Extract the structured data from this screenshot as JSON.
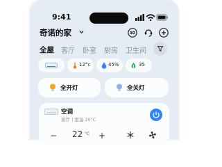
{
  "status": {
    "time": "9:41"
  },
  "header": {
    "title": "奇诺的家"
  },
  "tabs": [
    "全屋",
    "客厅",
    "卧室",
    "厨房",
    "卫生间"
  ],
  "chips": [
    {
      "icon": "ac-unit-icon",
      "text": ""
    },
    {
      "icon": "thermometer-icon",
      "text": "12°c"
    },
    {
      "icon": "humidity-icon",
      "text": "45%"
    },
    {
      "icon": "air-quality-icon",
      "text": "35"
    }
  ],
  "light_cards": [
    {
      "label": "全开灯"
    },
    {
      "label": "全关灯"
    }
  ],
  "ac": {
    "name": "空调",
    "sub": "客厅 | 室温 20°C",
    "minus": "−",
    "temp": "22",
    "unit": "°C",
    "plus": "+"
  },
  "colors": {
    "accent": "#2f86f0",
    "background": "#e6ecf3"
  }
}
